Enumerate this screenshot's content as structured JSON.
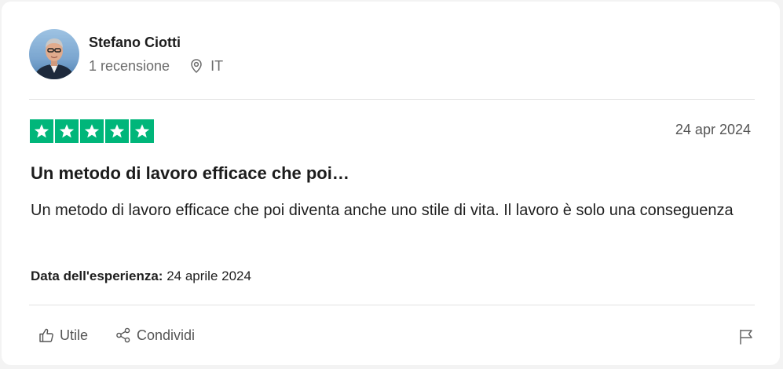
{
  "reviewer": {
    "name": "Stefano Ciotti",
    "review_count": "1 recensione",
    "country": "IT"
  },
  "review": {
    "rating": 5,
    "rating_max": 5,
    "date": "24 apr 2024",
    "title": "Un metodo di lavoro efficace che poi…",
    "body": "Un metodo di lavoro efficace che poi diventa anche uno stile di vita. Il lavoro è solo una conseguenza",
    "experience_label": "Data dell'esperienza:",
    "experience_date": "24 aprile 2024"
  },
  "actions": {
    "useful_label": "Utile",
    "share_label": "Condividi"
  },
  "icons": {
    "location": "location-pin-icon",
    "useful": "thumbs-up-icon",
    "share": "share-icon",
    "report": "flag-icon"
  },
  "colors": {
    "star_background": "#00b67a",
    "star": "#ffffff",
    "text": "#1c1c1c",
    "muted": "#6b6b6b",
    "divider": "#e2e2e2"
  }
}
